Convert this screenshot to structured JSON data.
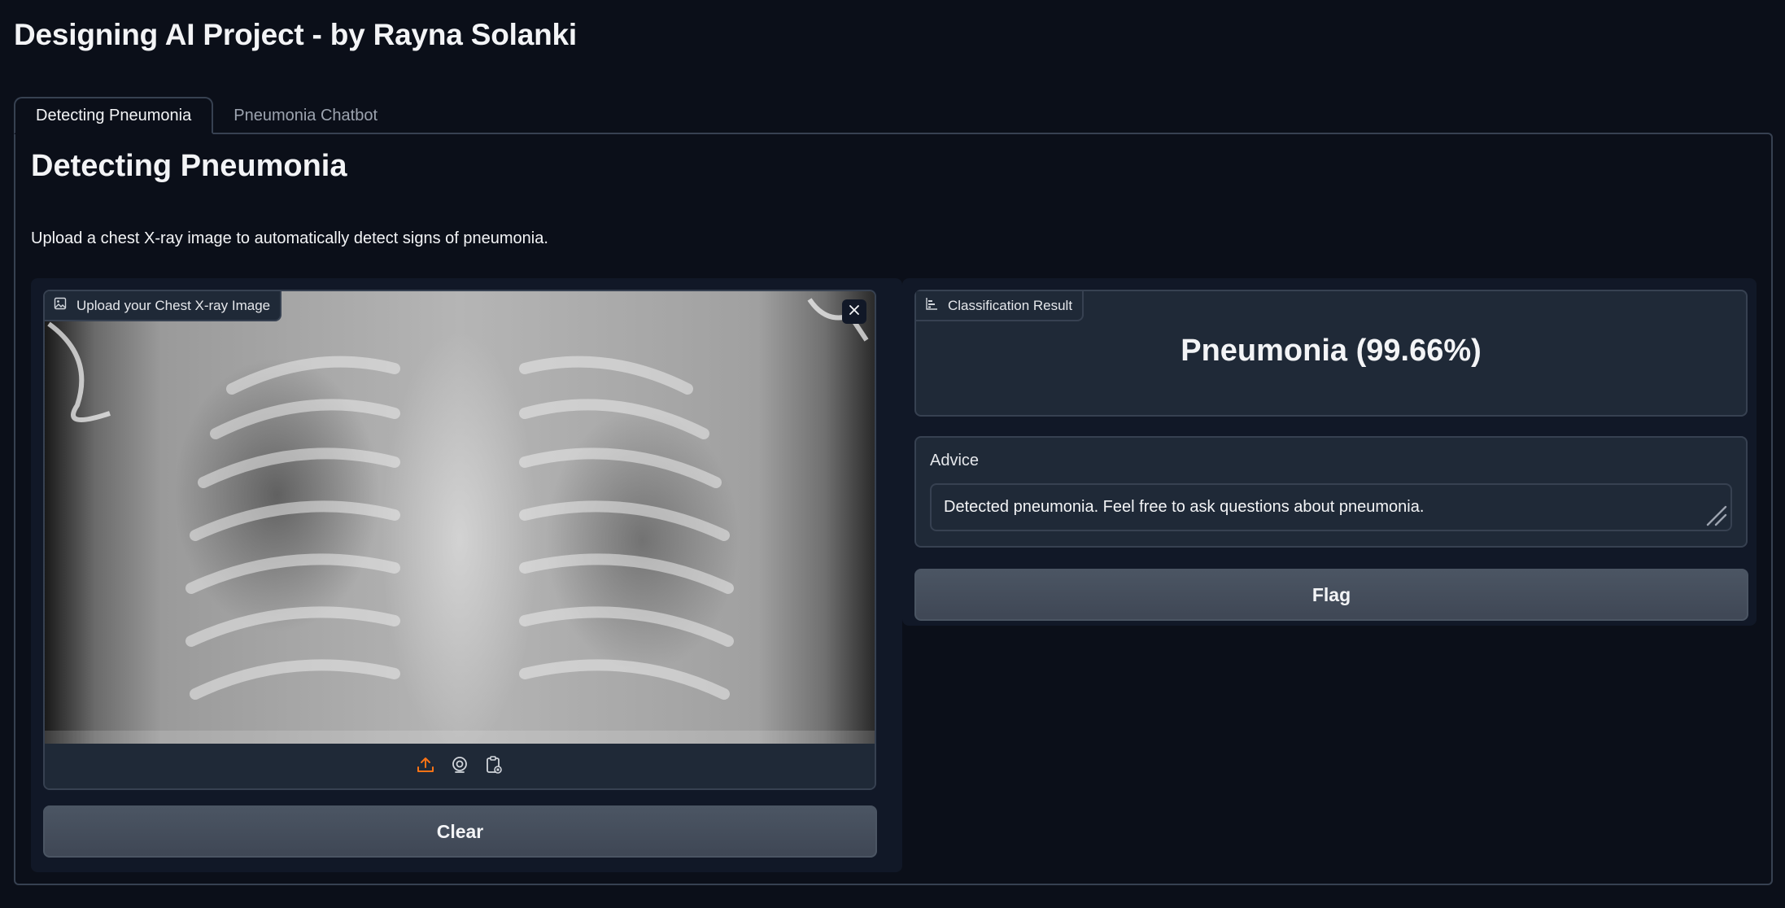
{
  "app": {
    "title": "Designing AI Project - by Rayna Solanki"
  },
  "tabs": [
    {
      "label": "Detecting Pneumonia",
      "active": true
    },
    {
      "label": "Pneumonia Chatbot",
      "active": false
    }
  ],
  "panel": {
    "heading": "Detecting Pneumonia",
    "description": "Upload a chest X-ray image to automatically detect signs of pneumonia."
  },
  "image_input": {
    "label": "Upload your Chest X-ray Image",
    "icon": "image-icon",
    "sources": [
      "upload-icon",
      "webcam-icon",
      "clipboard-icon"
    ]
  },
  "buttons": {
    "clear": "Clear",
    "flag": "Flag"
  },
  "result": {
    "label": "Classification Result",
    "icon": "bar-chart-icon",
    "value": "Pneumonia (99.66%)"
  },
  "advice": {
    "label": "Advice",
    "text": "Detected pneumonia. Feel free to ask questions about pneumonia."
  },
  "colors": {
    "background": "#0b0f19",
    "panel": "#111827",
    "block": "#1f2937",
    "border": "#374151",
    "button": "#4b5563",
    "accent_orange": "#f97316"
  }
}
